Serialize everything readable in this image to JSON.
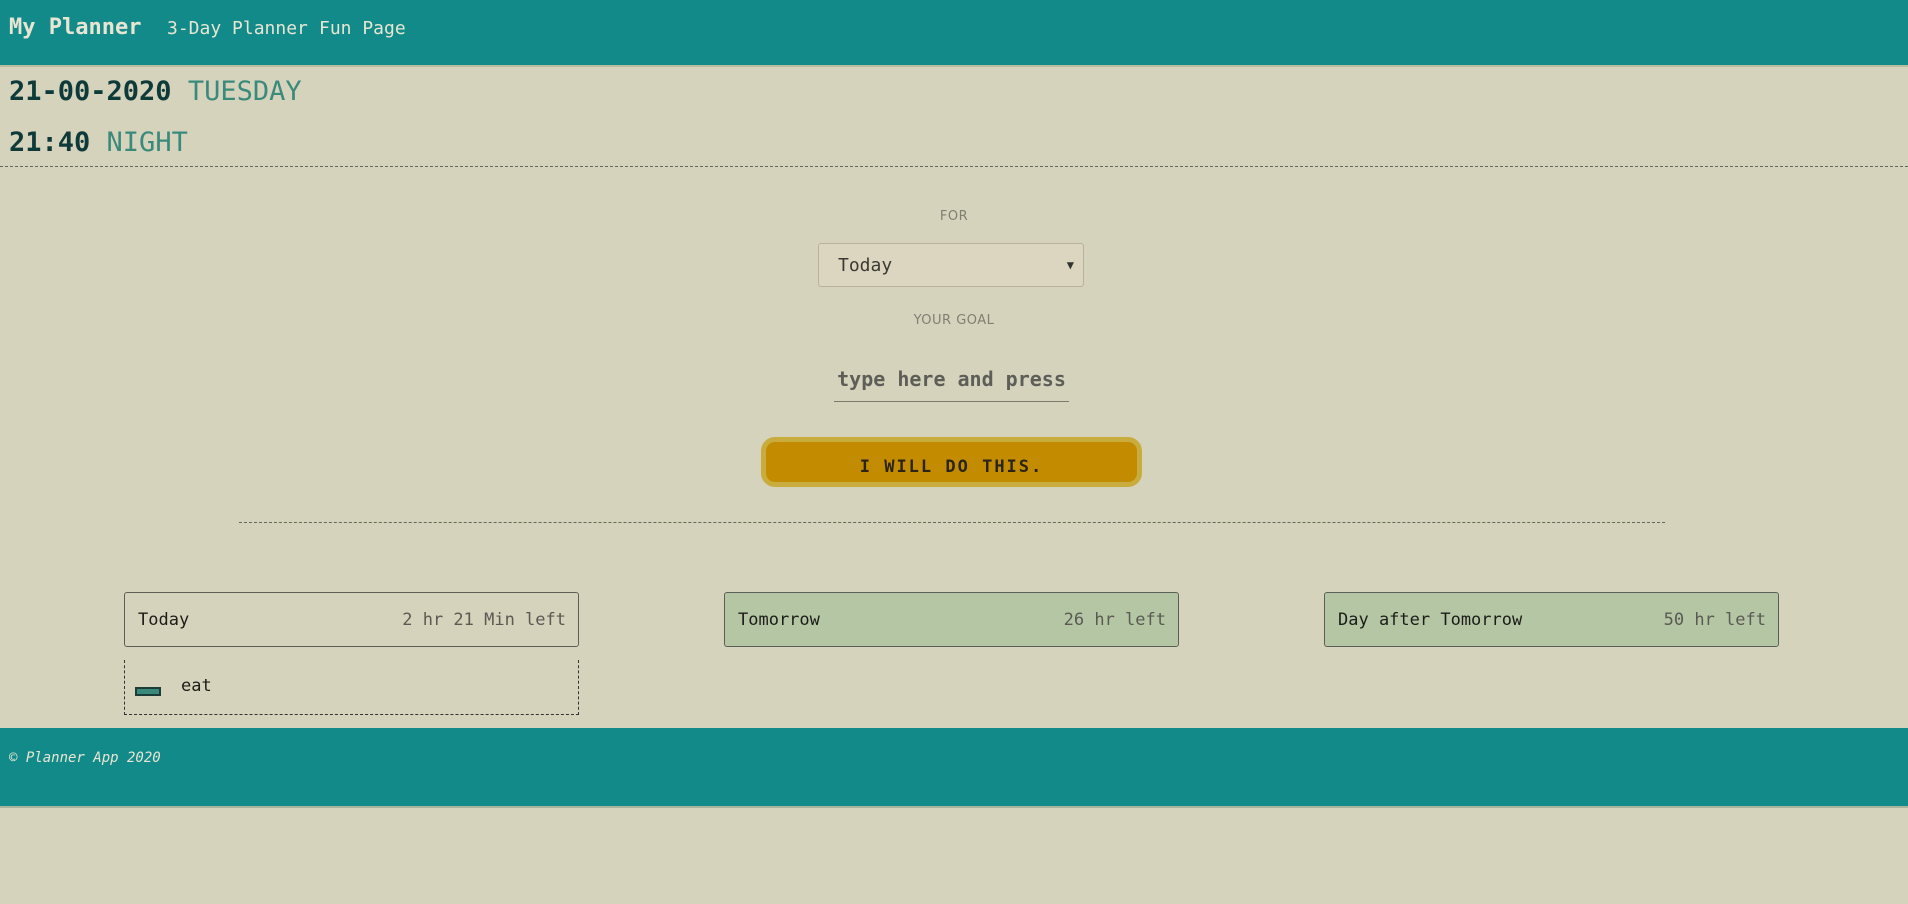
{
  "header": {
    "brand": "My Planner",
    "nav": [
      {
        "label": "3-Day Planner"
      },
      {
        "label": "Fun Page"
      }
    ]
  },
  "clock": {
    "date": "21-00-2020",
    "weekday": "TUESDAY",
    "time": "21:40",
    "period": "NIGHT"
  },
  "form": {
    "for_label": "FOR",
    "selected_day": "Today",
    "goal_label": "YOUR GOAL",
    "goal_placeholder": "type here and press",
    "goal_value": "",
    "submit_label": "I WILL DO THIS."
  },
  "days": [
    {
      "name": "Today",
      "remaining": "2 hr 21 Min left",
      "active": true
    },
    {
      "name": "Tomorrow",
      "remaining": "26 hr left",
      "active": false
    },
    {
      "name": "Day after Tomorrow",
      "remaining": "50 hr left",
      "active": false
    }
  ],
  "tasks": [
    {
      "text": "eat"
    }
  ],
  "footer": {
    "copyright": "© Planner App 2020"
  },
  "colors": {
    "background": "#d5d3bc",
    "bar": "#138a8a",
    "button": "#c38c00",
    "card_inactive": "#b5c6a5",
    "accent_text": "#3a8a7c"
  }
}
